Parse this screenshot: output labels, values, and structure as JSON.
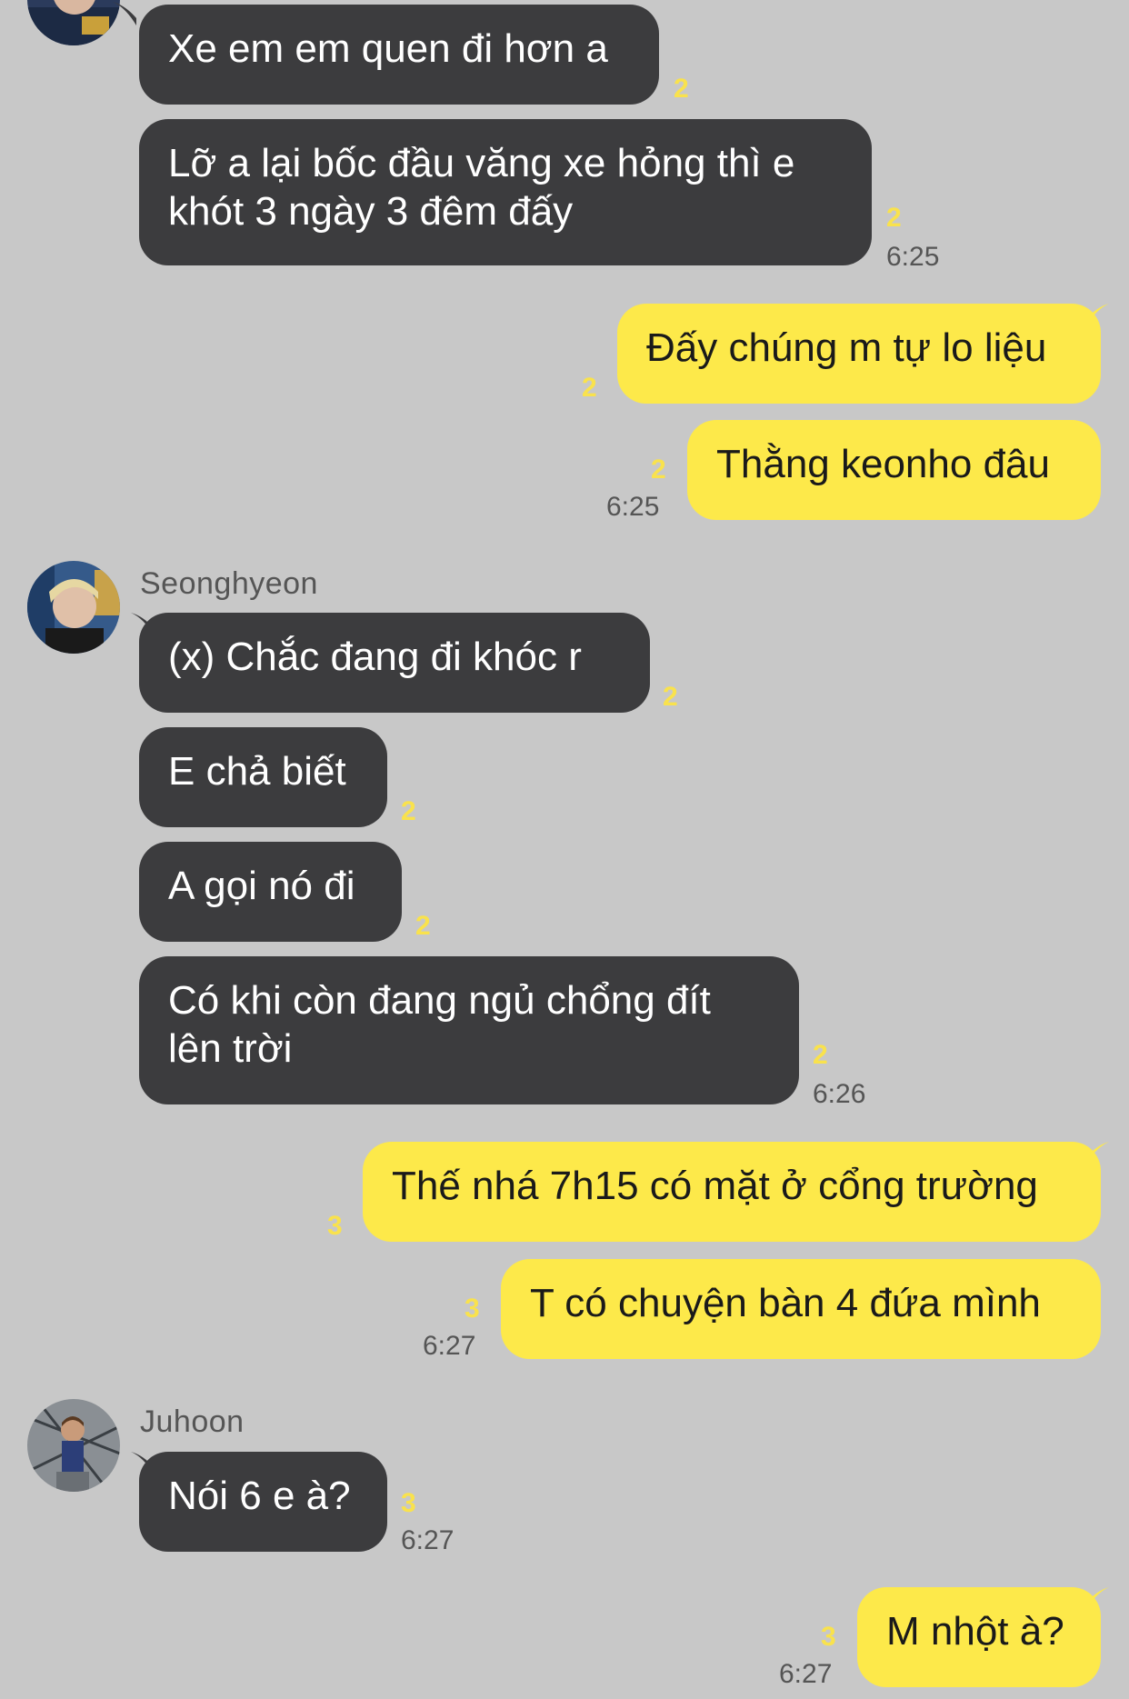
{
  "colors": {
    "background": "#c8c8c8",
    "incoming_bubble": "#3c3c3e",
    "outgoing_bubble": "#fde94a",
    "unread_count": "#f9e24d"
  },
  "senders": {
    "seonghyeon": {
      "name": "Seonghyeon"
    },
    "juhoon": {
      "name": "Juhoon"
    }
  },
  "messages": [
    {
      "text": "Xe em em quen đi hơn a",
      "unread": "2"
    },
    {
      "line1": "Lỡ a lại bốc đầu văng xe hỏng thì e",
      "line2": "khót 3 ngày 3 đêm đấy",
      "unread": "2",
      "time": "6:25"
    },
    {
      "text": "Đấy chúng m tự lo liệu",
      "unread": "2"
    },
    {
      "text": "Thằng keonho đâu",
      "unread": "2",
      "time": "6:25"
    },
    {
      "text": "(x) Chắc đang đi khóc r",
      "unread": "2"
    },
    {
      "text": "E chả biết",
      "unread": "2"
    },
    {
      "text": "A gọi nó đi",
      "unread": "2"
    },
    {
      "line1": "Có khi còn đang ngủ chổng đít",
      "line2": "lên trời",
      "unread": "2",
      "time": "6:26"
    },
    {
      "text": "Thế nhá 7h15 có mặt ở cổng trường",
      "unread": "3"
    },
    {
      "text": "T có chuyện bàn 4 đứa mình",
      "unread": "3",
      "time": "6:27"
    },
    {
      "text": "Nói 6 e à?",
      "unread": "3",
      "time": "6:27"
    },
    {
      "text": "M nhột à?",
      "unread": "3",
      "time": "6:27"
    }
  ]
}
